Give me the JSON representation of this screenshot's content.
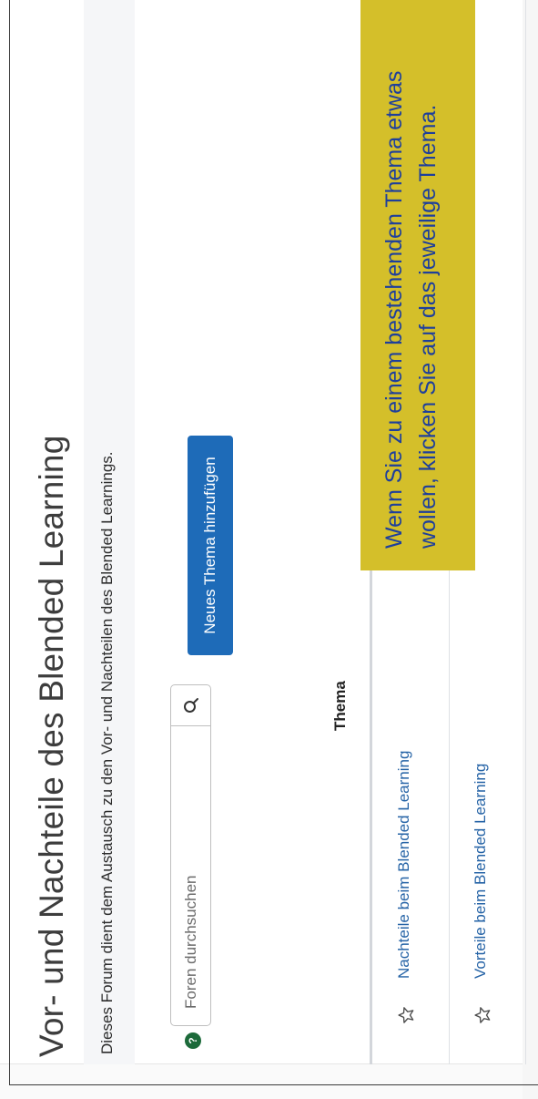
{
  "forum": {
    "title": "Vor- und Nachteile des Blended Learning",
    "description": "Dieses Forum dient dem Austausch zu den Vor- und Nachteilen des Blended Learnings."
  },
  "help": {
    "icon": "?"
  },
  "search": {
    "placeholder": "Foren durchsuchen",
    "value": ""
  },
  "actions": {
    "new_topic_label": "Neues Thema hinzufügen"
  },
  "table": {
    "header_label": "Thema",
    "rows": [
      {
        "label": "Nachteile beim Blended Learning"
      },
      {
        "label": "Vorteile beim Blended Learning"
      }
    ]
  },
  "tooltip": {
    "line1": "Wenn Sie zu einem bestehenden Thema etwas",
    "line2": "wollen, klicken Sie auf das jeweilige Thema."
  },
  "colors": {
    "primary_button": "#1e6bb8",
    "link": "#2563a6",
    "tooltip_bg": "#d4bf2a",
    "tooltip_text": "#1e3f9c",
    "help_icon": "#1c6a3a"
  }
}
